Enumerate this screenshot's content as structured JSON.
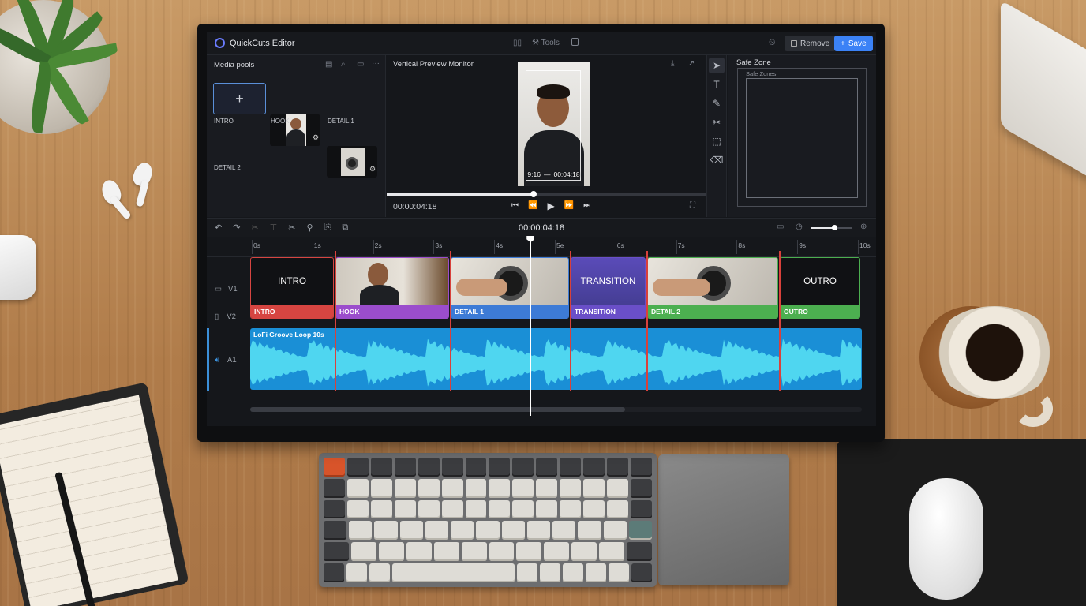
{
  "app": {
    "title": "QuickCuts Editor"
  },
  "topbar": {
    "tools_label": "Tools",
    "remove_label": "Remove",
    "save_label": "Save"
  },
  "media": {
    "title": "Media pools",
    "items": [
      {
        "label": "INTRO",
        "kind": "add"
      },
      {
        "label": "HOOK",
        "kind": "person"
      },
      {
        "label": "DETAIL 1",
        "kind": "hands"
      },
      {
        "label": "DETAIL 2",
        "kind": "hands"
      }
    ]
  },
  "preview": {
    "title": "Vertical Preview Monitor",
    "aspect": "9:16",
    "overlay_time": "00:04:18",
    "current_time": "00:00:04:18",
    "scrub_progress": 0.46
  },
  "safezone": {
    "title": "Safe Zone",
    "inner_label": "Safe Zones"
  },
  "timeline": {
    "timecode": "00:00:04:18",
    "zoom_level": 0.55,
    "ruler": [
      "0s",
      "1s",
      "2s",
      "3s",
      "4s",
      "5e",
      "6s",
      "7s",
      "8s",
      "9s",
      "10s"
    ],
    "tracks": {
      "v1": "V1",
      "v2": "V2",
      "a1": "A1"
    },
    "clips": [
      {
        "title": "INTRO",
        "label": "INTRO",
        "color": "#d64541",
        "kind": "title"
      },
      {
        "title": "",
        "label": "HOOK",
        "color": "#9b4dcc",
        "kind": "person"
      },
      {
        "title": "",
        "label": "DETAIL 1",
        "color": "#3d7bd6",
        "kind": "hands"
      },
      {
        "title": "TRANSITION",
        "label": "TRANSITION",
        "color": "#6a4fc8",
        "kind": "transition"
      },
      {
        "title": "",
        "label": "DETAIL 2",
        "color": "#4caf50",
        "kind": "hands"
      },
      {
        "title": "OUTRO",
        "label": "OUTRO",
        "color": "#4caf50",
        "kind": "title"
      }
    ],
    "audio": {
      "label": "LoFi Groove Loop 10s",
      "color": "#1a8fd6",
      "wave_color": "#4fd6f0"
    }
  },
  "colors": {
    "accent": "#3b82f6",
    "playhead": "#ffffff",
    "cut": "#d9413b"
  }
}
